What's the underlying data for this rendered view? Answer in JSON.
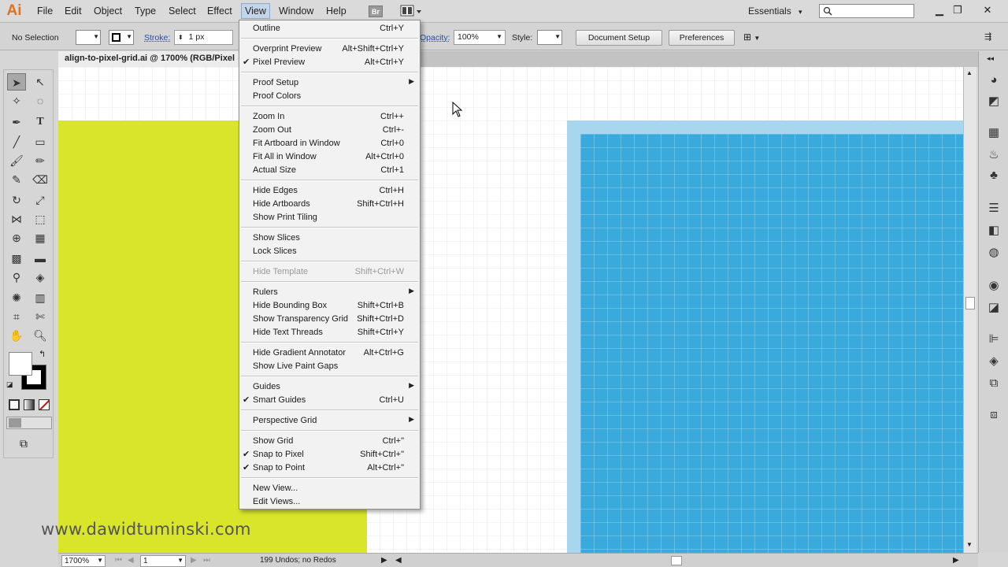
{
  "app": {
    "logo": "Ai"
  },
  "menubar": {
    "items": [
      "File",
      "Edit",
      "Object",
      "Type",
      "Select",
      "Effect",
      "View",
      "Window",
      "Help"
    ],
    "bridge_label": "Br",
    "workspace": "Essentials",
    "workspace_caret": "▾"
  },
  "controlbar": {
    "selection": "No Selection",
    "stroke_label": "Stroke:",
    "stroke_value": "1 px",
    "opacity_label": "Opacity:",
    "opacity_value": "100%",
    "style_label": "Style:",
    "document_setup": "Document Setup",
    "preferences": "Preferences"
  },
  "document": {
    "tab_title": "align-to-pixel-grid.ai @ 1700% (RGB/Pixel"
  },
  "view_menu": [
    {
      "label": "Outline",
      "shortcut": "Ctrl+Y"
    },
    {
      "sep": true
    },
    {
      "label": "Overprint Preview",
      "shortcut": "Alt+Shift+Ctrl+Y"
    },
    {
      "label": "Pixel Preview",
      "shortcut": "Alt+Ctrl+Y",
      "checked": true
    },
    {
      "sep": true
    },
    {
      "label": "Proof Setup",
      "submenu": true
    },
    {
      "label": "Proof Colors"
    },
    {
      "sep": true
    },
    {
      "label": "Zoom In",
      "shortcut": "Ctrl++"
    },
    {
      "label": "Zoom Out",
      "shortcut": "Ctrl+-"
    },
    {
      "label": "Fit Artboard in Window",
      "shortcut": "Ctrl+0"
    },
    {
      "label": "Fit All in Window",
      "shortcut": "Alt+Ctrl+0"
    },
    {
      "label": "Actual Size",
      "shortcut": "Ctrl+1"
    },
    {
      "sep": true
    },
    {
      "label": "Hide Edges",
      "shortcut": "Ctrl+H"
    },
    {
      "label": "Hide Artboards",
      "shortcut": "Shift+Ctrl+H"
    },
    {
      "label": "Show Print Tiling"
    },
    {
      "sep": true
    },
    {
      "label": "Show Slices"
    },
    {
      "label": "Lock Slices"
    },
    {
      "sep": true
    },
    {
      "label": "Hide Template",
      "shortcut": "Shift+Ctrl+W",
      "disabled": true
    },
    {
      "sep": true
    },
    {
      "label": "Rulers",
      "submenu": true
    },
    {
      "label": "Hide Bounding Box",
      "shortcut": "Shift+Ctrl+B"
    },
    {
      "label": "Show Transparency Grid",
      "shortcut": "Shift+Ctrl+D"
    },
    {
      "label": "Hide Text Threads",
      "shortcut": "Shift+Ctrl+Y"
    },
    {
      "sep": true
    },
    {
      "label": "Hide Gradient Annotator",
      "shortcut": "Alt+Ctrl+G"
    },
    {
      "label": "Show Live Paint Gaps"
    },
    {
      "sep": true
    },
    {
      "label": "Guides",
      "submenu": true
    },
    {
      "label": "Smart Guides",
      "shortcut": "Ctrl+U",
      "checked": true
    },
    {
      "sep": true
    },
    {
      "label": "Perspective Grid",
      "submenu": true
    },
    {
      "sep": true
    },
    {
      "label": "Show Grid",
      "shortcut": "Ctrl+\""
    },
    {
      "label": "Snap to Pixel",
      "shortcut": "Shift+Ctrl+\"",
      "checked": true
    },
    {
      "label": "Snap to Point",
      "shortcut": "Alt+Ctrl+\"",
      "checked": true
    },
    {
      "sep": true
    },
    {
      "label": "New View..."
    },
    {
      "label": "Edit Views..."
    }
  ],
  "statusbar": {
    "zoom": "1700%",
    "artboard": "1",
    "history": "199 Undos; no Redos"
  },
  "watermark": "www.dawidtuminski.com",
  "colors": {
    "yellow_shape": "#d8e52a",
    "blue_shape": "#39aadb",
    "blue_border": "#a7d6ee",
    "logo": "#e3701c"
  }
}
